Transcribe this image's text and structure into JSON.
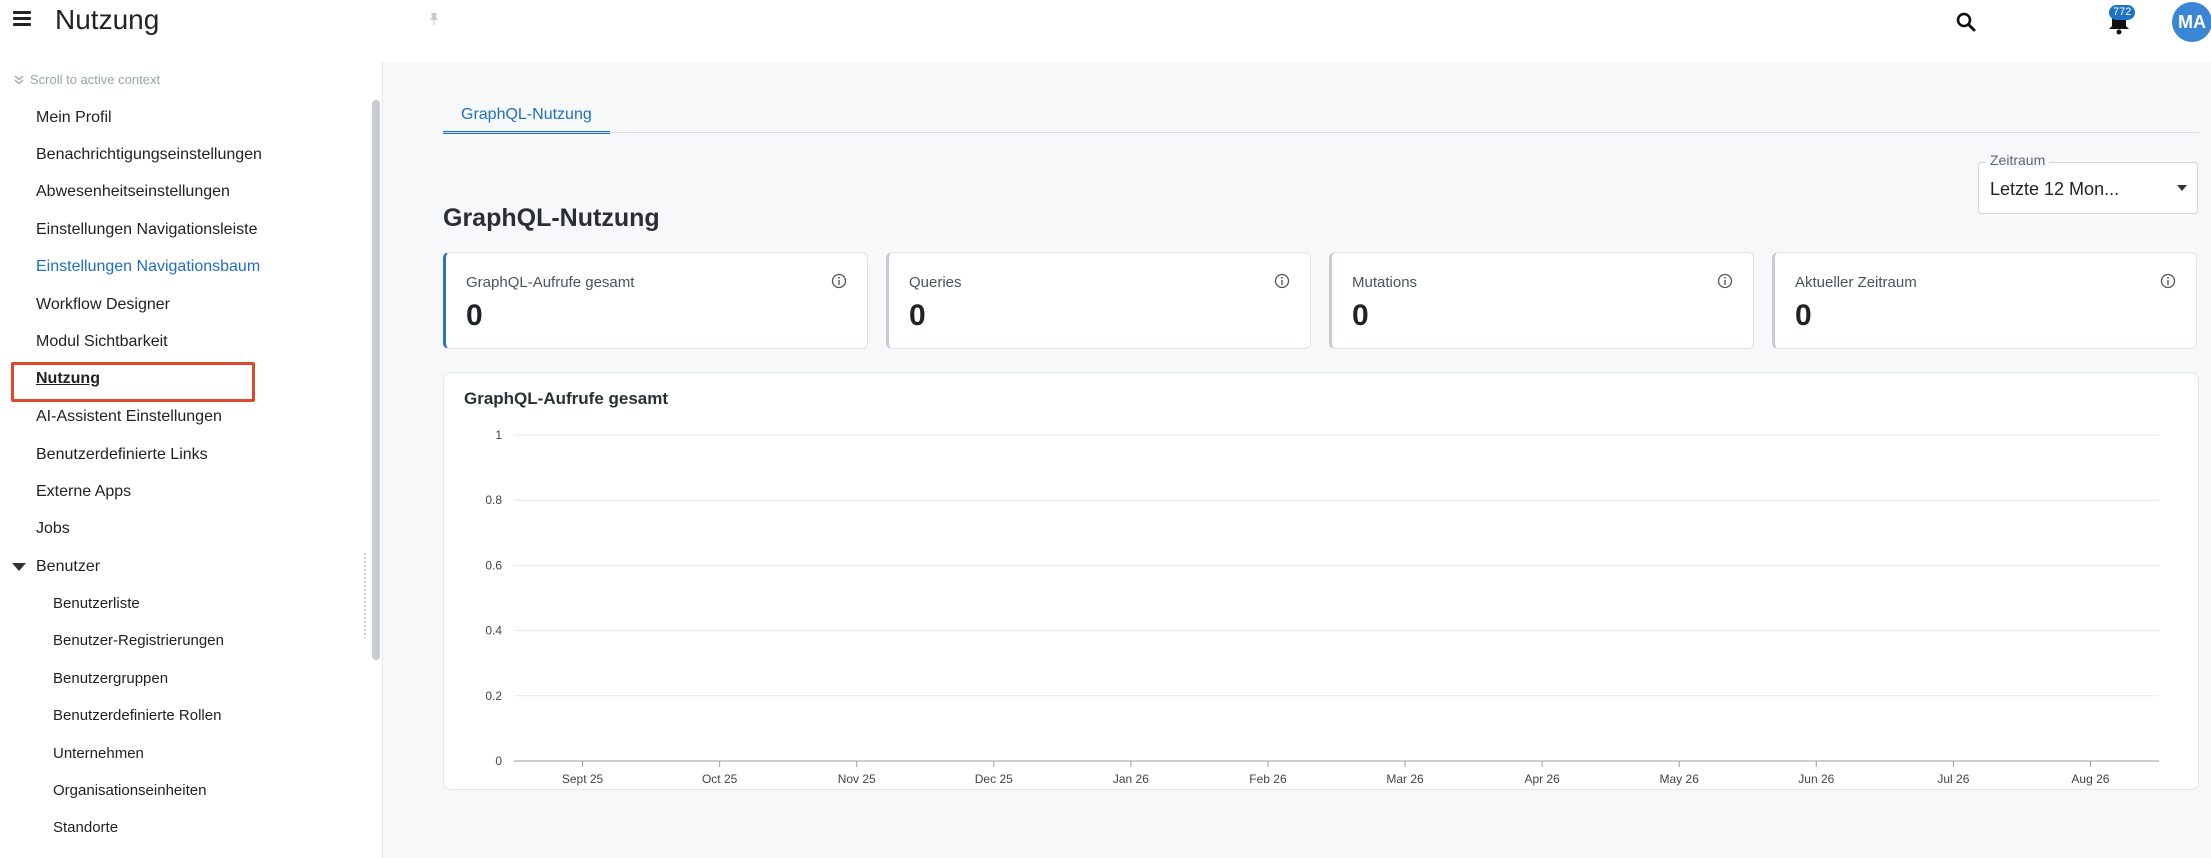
{
  "header": {
    "title": "Nutzung",
    "notification_count": "772",
    "avatar_initials": "MA"
  },
  "sidebar": {
    "scroll_context": "Scroll to active context",
    "items": [
      {
        "label": "Mein Profil"
      },
      {
        "label": "Benachrichtigungseinstellungen"
      },
      {
        "label": "Abwesenheitseinstellungen"
      },
      {
        "label": "Einstellungen Navigationsleiste"
      },
      {
        "label": "Einstellungen Navigationsbaum"
      },
      {
        "label": "Workflow Designer"
      },
      {
        "label": "Modul Sichtbarkeit"
      },
      {
        "label": "Nutzung"
      },
      {
        "label": "AI-Assistent Einstellungen"
      },
      {
        "label": "Benutzerdefinierte Links"
      },
      {
        "label": "Externe Apps"
      },
      {
        "label": "Jobs"
      },
      {
        "label": "Benutzer"
      }
    ],
    "sub_items": [
      {
        "label": "Benutzerliste"
      },
      {
        "label": "Benutzer-Registrierungen"
      },
      {
        "label": "Benutzergruppen"
      },
      {
        "label": "Benutzerdefinierte Rollen"
      },
      {
        "label": "Unternehmen"
      },
      {
        "label": "Organisationseinheiten"
      },
      {
        "label": "Standorte"
      }
    ]
  },
  "main": {
    "tab_label": "GraphQL-Nutzung",
    "range": {
      "label": "Zeitraum",
      "value": "Letzte 12 Mon..."
    },
    "heading": "GraphQL-Nutzung",
    "stats": [
      {
        "title": "GraphQL-Aufrufe gesamt",
        "value": "0"
      },
      {
        "title": "Queries",
        "value": "0"
      },
      {
        "title": "Mutations",
        "value": "0"
      },
      {
        "title": "Aktueller Zeitraum",
        "value": "0"
      }
    ],
    "chart_title": "GraphQL-Aufrufe gesamt"
  },
  "colors": {
    "accent": "#1e6fc0",
    "highlight": "#e0482a"
  },
  "chart_data": {
    "type": "line",
    "title": "GraphQL-Aufrufe gesamt",
    "categories": [
      "Sept 25",
      "Oct 25",
      "Nov 25",
      "Dec 25",
      "Jan 26",
      "Feb 26",
      "Mar 26",
      "Apr 26",
      "May 26",
      "Jun 26",
      "Jul 26",
      "Aug 26"
    ],
    "series": [
      {
        "values": [
          0,
          0,
          0,
          0,
          0,
          0,
          0,
          0,
          0,
          0,
          0,
          0
        ]
      }
    ],
    "yticks": [
      "0",
      "0.2",
      "0.4",
      "0.6",
      "0.8",
      "1"
    ],
    "ylim": [
      0,
      1
    ],
    "grid": true
  }
}
